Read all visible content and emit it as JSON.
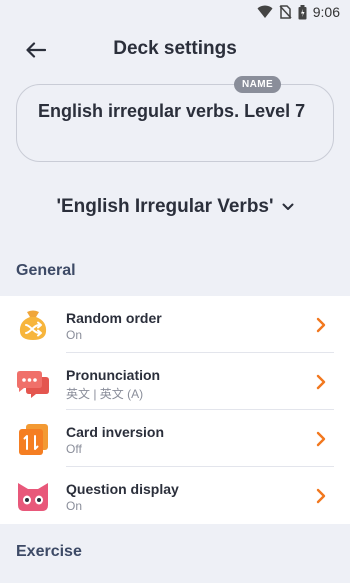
{
  "status_bar": {
    "time": "9:06",
    "icons": [
      "wifi-icon",
      "no-sim-icon",
      "battery-icon"
    ]
  },
  "header": {
    "title": "Deck settings",
    "back_icon": "arrow-left-icon"
  },
  "name_field": {
    "badge": "NAME",
    "value": "English irregular verbs. Level 7"
  },
  "deck_selector": {
    "value": "'English Irregular Verbs'",
    "icon": "chevron-down-icon"
  },
  "sections": {
    "general": "General",
    "exercise": "Exercise"
  },
  "settings": [
    {
      "title": "Random order",
      "value": "On",
      "icon": "shuffle-bag-icon"
    },
    {
      "title": "Pronunciation",
      "value": "英文 | 英文 (A)",
      "icon": "speech-bubbles-icon"
    },
    {
      "title": "Card inversion",
      "value": "Off",
      "icon": "card-inversion-icon"
    },
    {
      "title": "Question display",
      "value": "On",
      "icon": "cat-face-icon"
    }
  ],
  "colors": {
    "accent": "#f2781f",
    "background": "#eef0f6",
    "section_title": "#3d4a66"
  }
}
